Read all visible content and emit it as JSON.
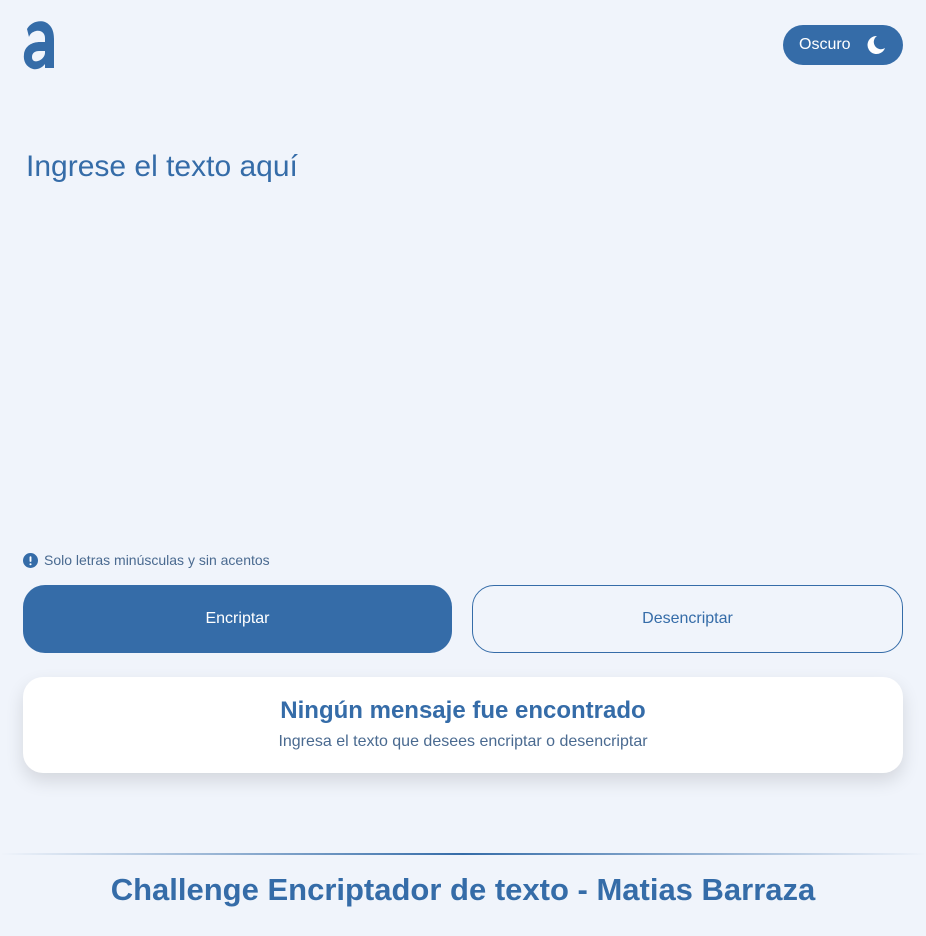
{
  "header": {
    "logo_icon": "alura-a-logo-icon",
    "theme_toggle_label": "Oscuro",
    "theme_toggle_icon": "moon-icon"
  },
  "input": {
    "placeholder": "Ingrese el texto aquí",
    "value": ""
  },
  "hint": {
    "icon": "info-icon",
    "text": "Solo letras minúsculas y sin acentos"
  },
  "actions": {
    "encrypt_label": "Encriptar",
    "decrypt_label": "Desencriptar"
  },
  "result": {
    "title": "Ningún mensaje fue encontrado",
    "subtitle": "Ingresa el texto que desees encriptar o desencriptar"
  },
  "footer": {
    "text": "Challenge Encriptador de texto - Matias Barraza"
  },
  "colors": {
    "accent": "#356ca8",
    "background": "#f0f4fb",
    "card": "#ffffff"
  }
}
